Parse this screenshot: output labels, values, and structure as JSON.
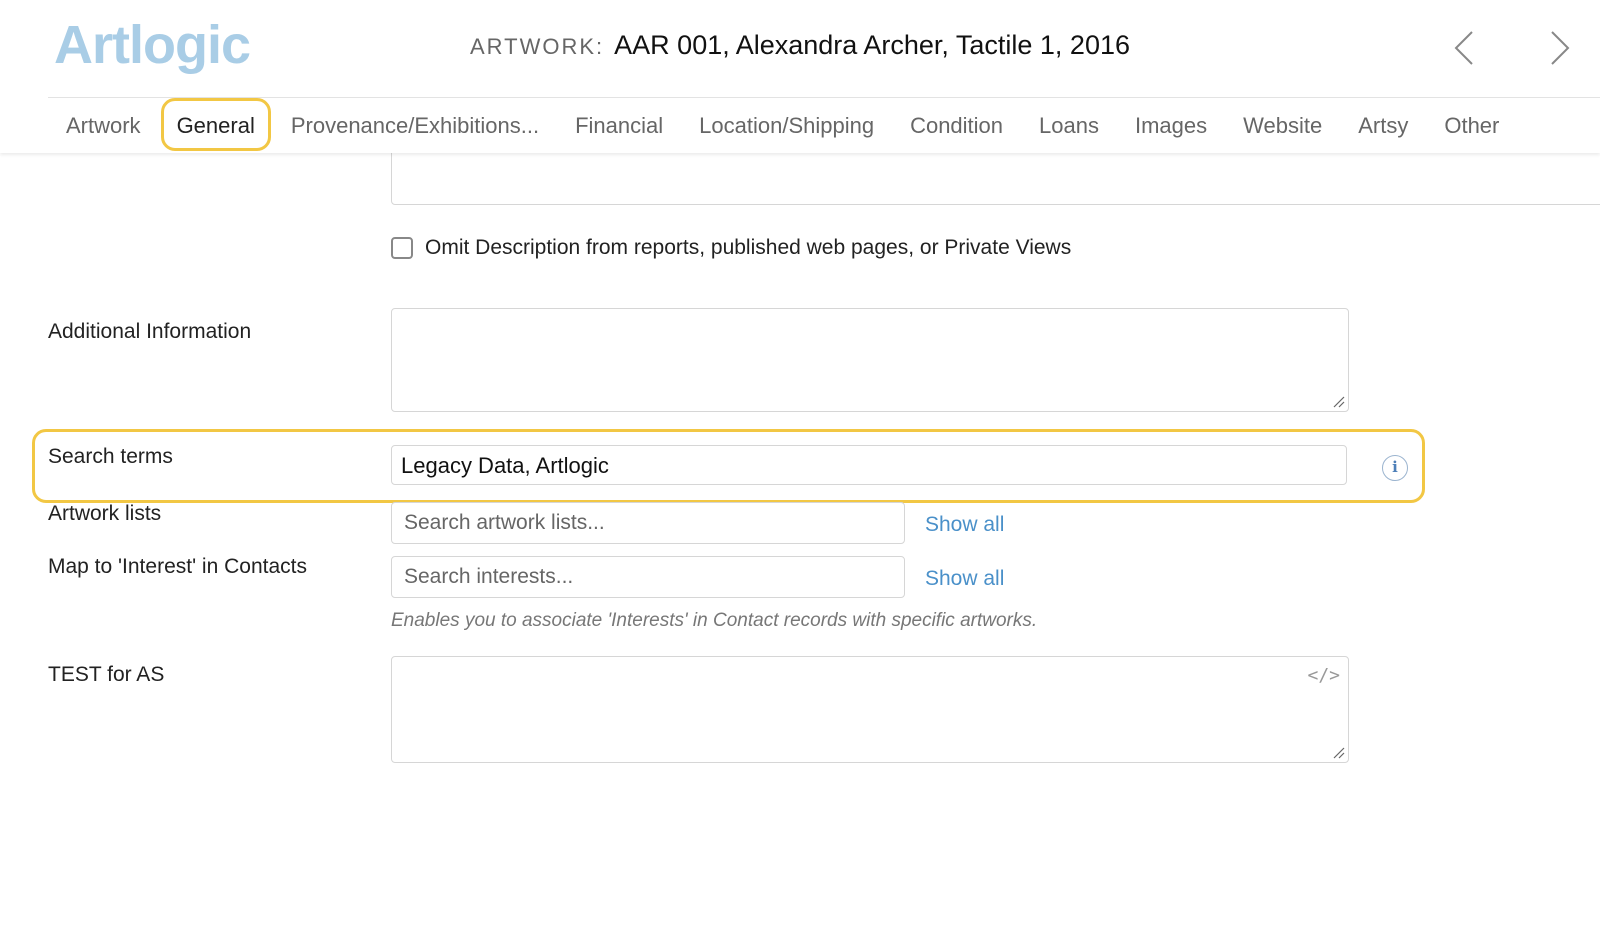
{
  "header": {
    "logo": "Artlogic",
    "title_prefix": "ARTWORK:",
    "title": "AAR 001, Alexandra Archer, Tactile 1, 2016"
  },
  "tabs": [
    {
      "label": "Artwork",
      "active": false
    },
    {
      "label": "General",
      "active": true
    },
    {
      "label": "Provenance/Exhibitions...",
      "active": false
    },
    {
      "label": "Financial",
      "active": false
    },
    {
      "label": "Location/Shipping",
      "active": false
    },
    {
      "label": "Condition",
      "active": false
    },
    {
      "label": "Loans",
      "active": false
    },
    {
      "label": "Images",
      "active": false
    },
    {
      "label": "Website",
      "active": false
    },
    {
      "label": "Artsy",
      "active": false
    },
    {
      "label": "Other",
      "active": false
    }
  ],
  "form": {
    "omit_description_label": "Omit Description from reports, published web pages, or Private Views",
    "omit_description_checked": false,
    "additional_information_label": "Additional Information",
    "search_terms_label": "Search terms",
    "search_terms_value": "Legacy Data, Artlogic",
    "search_terms_info_icon": "i",
    "artwork_lists_label": "Artwork lists",
    "artwork_lists_placeholder": "Search artwork lists...",
    "artwork_lists_show_all": "Show all",
    "interest_label": "Map to 'Interest' in Contacts",
    "interest_placeholder": "Search interests...",
    "interest_show_all": "Show all",
    "interest_helper": "Enables you to associate 'Interests' in Contact records with specific artworks.",
    "test_label": "TEST for AS",
    "code_toggle": "</>"
  },
  "colors": {
    "logo": "#a9cde6",
    "highlight": "#f2c744",
    "link": "#4a90c9"
  },
  "icons": {
    "prev": "chevron-left-icon",
    "next": "chevron-right-icon",
    "info": "info-icon",
    "code": "code-icon"
  }
}
